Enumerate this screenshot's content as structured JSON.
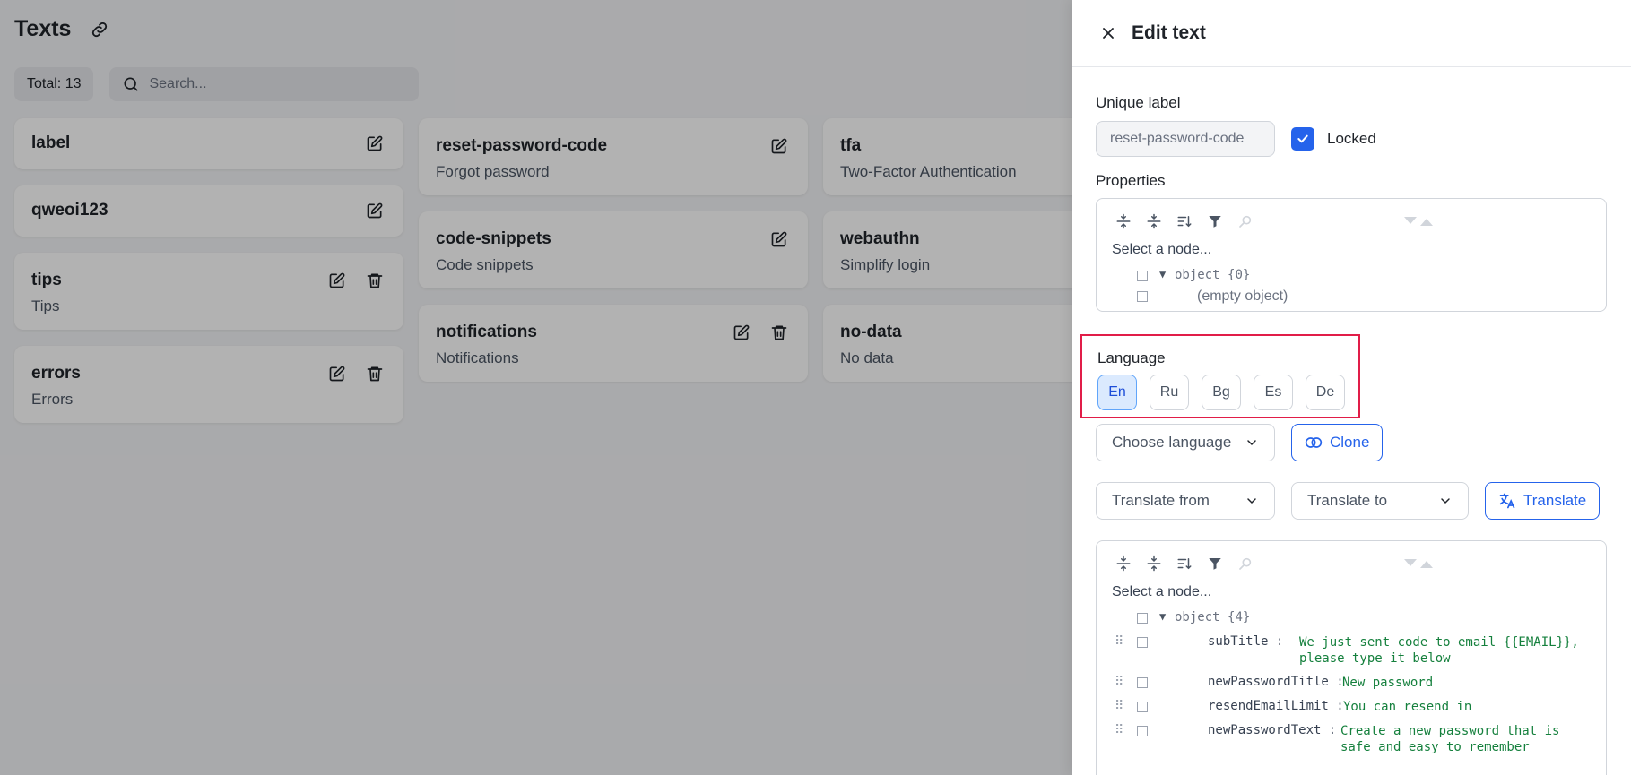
{
  "page": {
    "title": "Texts",
    "total": "Total: 13",
    "search_placeholder": "Search..."
  },
  "cards": {
    "col1": [
      {
        "title": "label",
        "subtitle": "",
        "deletable": false
      },
      {
        "title": "qweoi123",
        "subtitle": "",
        "deletable": false
      },
      {
        "title": "tips",
        "subtitle": "Tips",
        "deletable": true
      },
      {
        "title": "errors",
        "subtitle": "Errors",
        "deletable": true
      }
    ],
    "col2": [
      {
        "title": "reset-password-code",
        "subtitle": "Forgot password",
        "deletable": false
      },
      {
        "title": "code-snippets",
        "subtitle": "Code snippets",
        "deletable": false
      },
      {
        "title": "notifications",
        "subtitle": "Notifications",
        "deletable": true
      }
    ],
    "col3": [
      {
        "title": "tfa",
        "subtitle": "Two-Factor Authentication"
      },
      {
        "title": "webauthn",
        "subtitle": "Simplify login"
      },
      {
        "title": "no-data",
        "subtitle": "No data"
      }
    ]
  },
  "drawer": {
    "title": "Edit text",
    "unique_label": "Unique label",
    "unique_value": "reset-password-code",
    "locked_label": "Locked",
    "locked_checked": true,
    "properties_label": "Properties",
    "properties_editor": {
      "placeholder": "Select a node...",
      "root_label": "object",
      "root_count": "{0}",
      "empty_text": "(empty object)"
    },
    "language_label": "Language",
    "languages": [
      "En",
      "Ru",
      "Bg",
      "Es",
      "De"
    ],
    "active_language": "En",
    "choose_language": "Choose language",
    "clone_label": "Clone",
    "translate_from": "Translate from",
    "translate_to": "Translate to",
    "translate_label": "Translate",
    "texts_editor": {
      "placeholder": "Select a node...",
      "root_label": "object",
      "root_count": "{4}",
      "entries": [
        {
          "key": "subTitle",
          "value": "We just sent code to email {{EMAIL}},\nplease type it below"
        },
        {
          "key": "newPasswordTitle",
          "value": "New password"
        },
        {
          "key": "resendEmailLimit",
          "value": "You can resend in"
        },
        {
          "key": "newPasswordText",
          "value": "Create a new password that is\nsafe and easy to remember"
        }
      ]
    }
  },
  "colors": {
    "accent": "#2563eb",
    "highlight_border": "#e11d48",
    "json_value": "#15803d"
  }
}
